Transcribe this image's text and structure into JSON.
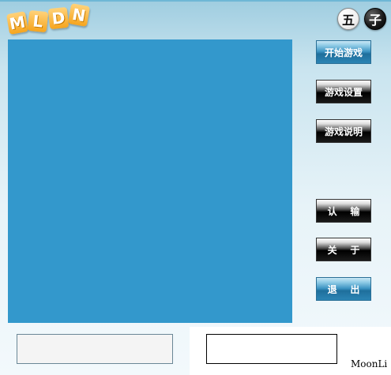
{
  "logo": {
    "letters": [
      "M",
      "L",
      "D",
      "N"
    ]
  },
  "pieces": {
    "white": "五",
    "black": "子"
  },
  "buttons": {
    "start": "开始游戏",
    "settings": "游戏设置",
    "help": "游戏说明",
    "resign": "认    输",
    "about": "关    于",
    "exit": "退    出"
  },
  "inputs": {
    "left_value": "",
    "right_value": ""
  },
  "footer": {
    "author": "MoonLi"
  }
}
